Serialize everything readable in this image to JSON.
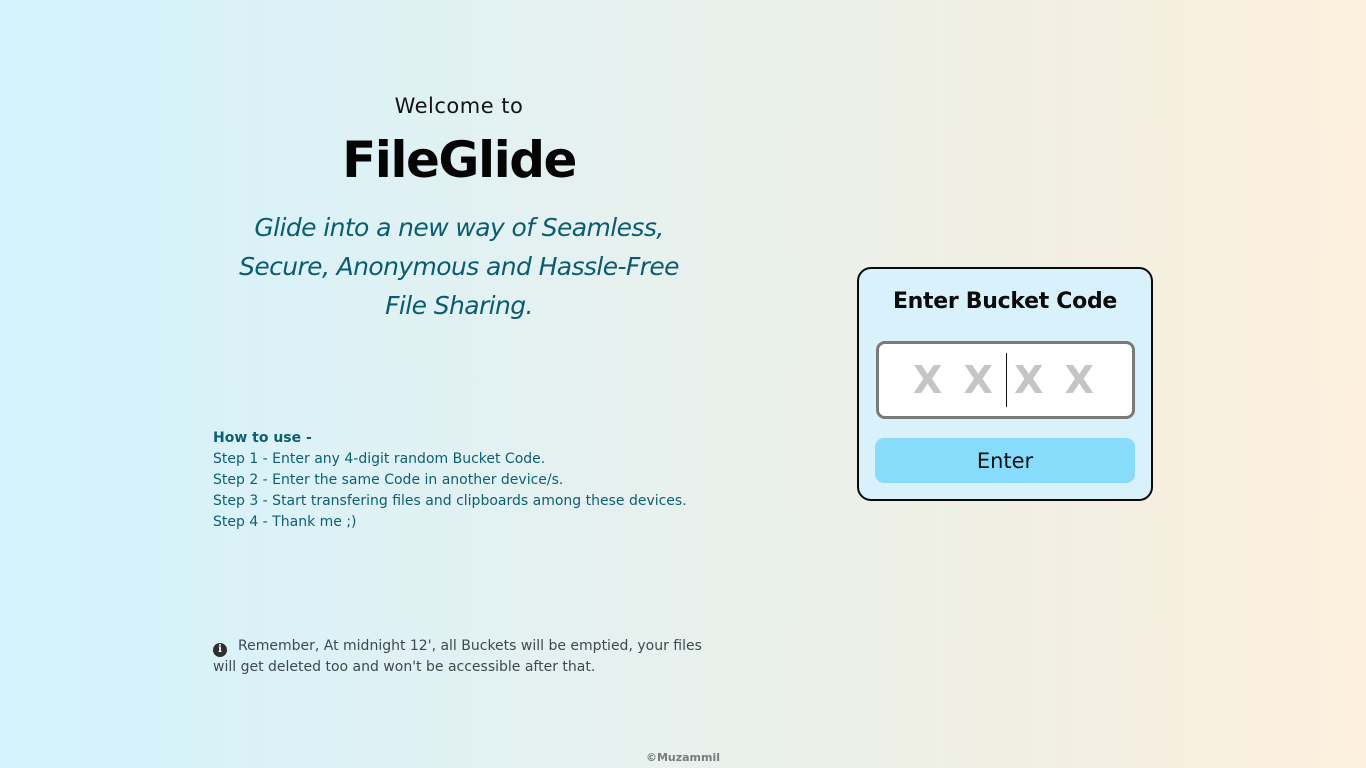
{
  "hero": {
    "welcome": "Welcome to",
    "brand": "FileGlide",
    "tagline_lines": [
      "Glide into a new way of Seamless,",
      "Secure, Anonymous and Hassle-Free",
      "File Sharing."
    ]
  },
  "how_to": {
    "title": "How to use -",
    "steps": [
      "Step 1 - Enter any 4-digit random Bucket Code.",
      "Step 2 - Enter the same Code in another device/s.",
      "Step 3 - Start transfering files and clipboards among these devices.",
      "Step 4 - Thank me ;)"
    ]
  },
  "notice": {
    "icon": "info-icon",
    "text": "Remember, At midnight 12', all Buckets will be emptied, your files will get deleted too and won't be accessible after that."
  },
  "card": {
    "title": "Enter Bucket Code",
    "input_placeholder": "X X X X",
    "input_value": "",
    "button_label": "Enter"
  },
  "footer": {
    "copyright": "©Muzammil"
  },
  "colors": {
    "tagline": "#0c5c70",
    "button": "#86dcfa",
    "card_bg": "#d9f1fb"
  }
}
